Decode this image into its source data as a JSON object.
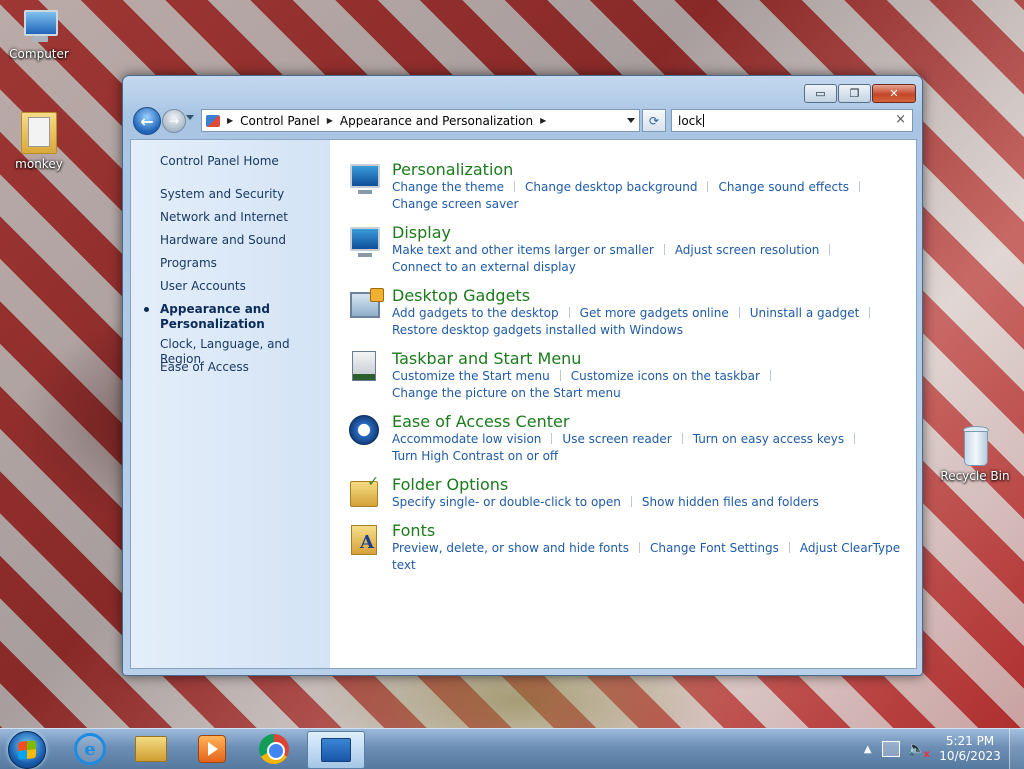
{
  "desktop": {
    "icons": [
      {
        "label": "Computer",
        "icon": "computer-icon"
      },
      {
        "label": "monkey",
        "icon": "folder-icon"
      },
      {
        "label": "Recycle Bin",
        "icon": "recycle-bin-icon"
      }
    ]
  },
  "window": {
    "title_buttons": {
      "minimize": "▭",
      "maximize": "❐",
      "close": "✕"
    },
    "nav": {
      "back": "←",
      "forward": "→"
    },
    "address": {
      "crumbs": [
        "Control Panel",
        "Appearance and Personalization"
      ],
      "separator": "▶"
    },
    "refresh": "⟳",
    "search": {
      "query": "lock",
      "clear": "×"
    }
  },
  "sidebar": {
    "home": "Control Panel Home",
    "items": [
      "System and Security",
      "Network and Internet",
      "Hardware and Sound",
      "Programs",
      "User Accounts",
      "Appearance and Personalization",
      "Clock, Language, and Region",
      "Ease of Access"
    ],
    "selected_index": 5
  },
  "categories": [
    {
      "title": "Personalization",
      "icon": "personalization-icon",
      "links": [
        "Change the theme",
        "Change desktop background",
        "Change sound effects",
        "Change screen saver"
      ]
    },
    {
      "title": "Display",
      "icon": "display-icon",
      "links": [
        "Make text and other items larger or smaller",
        "Adjust screen resolution",
        "Connect to an external display"
      ]
    },
    {
      "title": "Desktop Gadgets",
      "icon": "desktop-gadgets-icon",
      "links": [
        "Add gadgets to the desktop",
        "Get more gadgets online",
        "Uninstall a gadget",
        "Restore desktop gadgets installed with Windows"
      ]
    },
    {
      "title": "Taskbar and Start Menu",
      "icon": "taskbar-icon",
      "links": [
        "Customize the Start menu",
        "Customize icons on the taskbar",
        "Change the picture on the Start menu"
      ]
    },
    {
      "title": "Ease of Access Center",
      "icon": "ease-of-access-icon",
      "links": [
        "Accommodate low vision",
        "Use screen reader",
        "Turn on easy access keys",
        "Turn High Contrast on or off"
      ]
    },
    {
      "title": "Folder Options",
      "icon": "folder-options-icon",
      "links": [
        "Specify single- or double-click to open",
        "Show hidden files and folders"
      ]
    },
    {
      "title": "Fonts",
      "icon": "fonts-icon",
      "links": [
        "Preview, delete, or show and hide fonts",
        "Change Font Settings",
        "Adjust ClearType text"
      ]
    }
  ],
  "taskbar": {
    "apps": [
      "Internet Explorer",
      "Windows Explorer",
      "Windows Media Player",
      "Google Chrome",
      "Control Panel"
    ],
    "active_app": "Control Panel",
    "tray": {
      "overflow": "▲"
    },
    "clock": {
      "time": "5:21 PM",
      "date": "10/6/2023"
    }
  }
}
